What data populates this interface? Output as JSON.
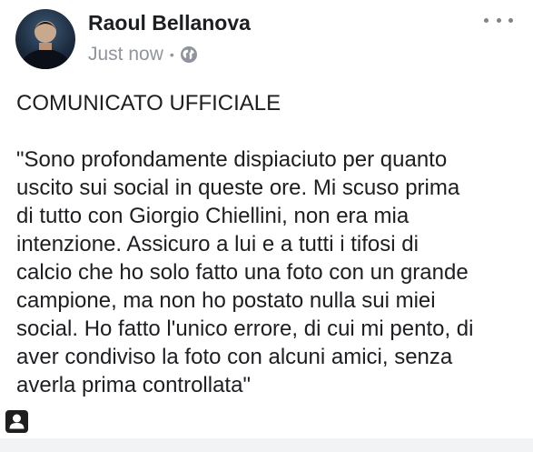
{
  "post": {
    "author": "Raoul Bellanova",
    "timestamp": "Just now",
    "separator": "•",
    "audience_icon": "globe-icon",
    "heading": "COMUNICATO UFFICIALE",
    "lines": [
      "\"Sono profondamente dispiaciuto per quanto",
      "uscito sui social in queste ore. Mi scuso prima",
      "di tutto con Giorgio Chiellini, non era mia",
      "intenzione. Assicuro a lui e a tutti i tifosi di",
      "calcio che ho solo fatto una foto con un grande",
      "campione, ma non ho postato nulla sui miei",
      "social. Ho fatto l'unico errore, di cui mi pento, di",
      "aver condiviso la foto con alcuni amici, senza",
      "averla prima controllata\""
    ]
  },
  "colors": {
    "author_text": "#1c1e21",
    "meta_text": "#90949c",
    "body_text": "#1c1e21",
    "background": "#ffffff",
    "footer_bar": "#f2f3f5"
  },
  "icons": {
    "more_options": "more-horizontal-icon",
    "profile_badge": "person-badge-icon"
  }
}
